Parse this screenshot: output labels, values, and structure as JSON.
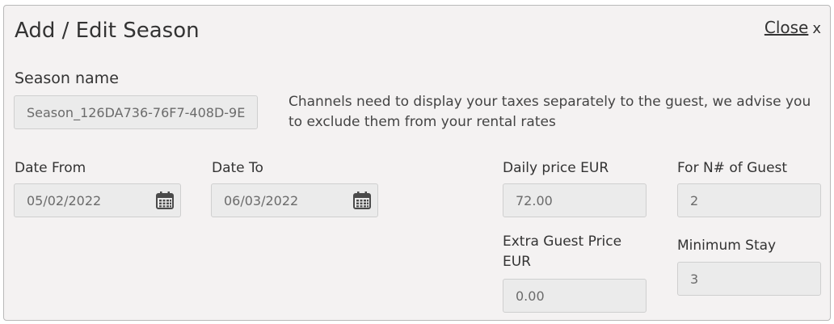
{
  "dialog": {
    "title": "Add / Edit Season",
    "close_label": "Close",
    "close_x": "x"
  },
  "season": {
    "label": "Season name",
    "value": "Season_126DA736-76F7-408D-9E"
  },
  "info_text": "Channels need to display your taxes separately to the guest, we advise you to exclude them from your rental rates",
  "date_from": {
    "label": "Date From",
    "value": "05/02/2022",
    "icon": "calendar-icon"
  },
  "date_to": {
    "label": "Date To",
    "value": "06/03/2022",
    "icon": "calendar-icon"
  },
  "daily_price": {
    "label": "Daily price EUR",
    "value": "72.00"
  },
  "guests": {
    "label": "For N# of Guest",
    "value": "2"
  },
  "extra_guest": {
    "label": "Extra Guest Price EUR",
    "value": "0.00"
  },
  "min_stay": {
    "label": "Minimum Stay",
    "value": "3"
  }
}
